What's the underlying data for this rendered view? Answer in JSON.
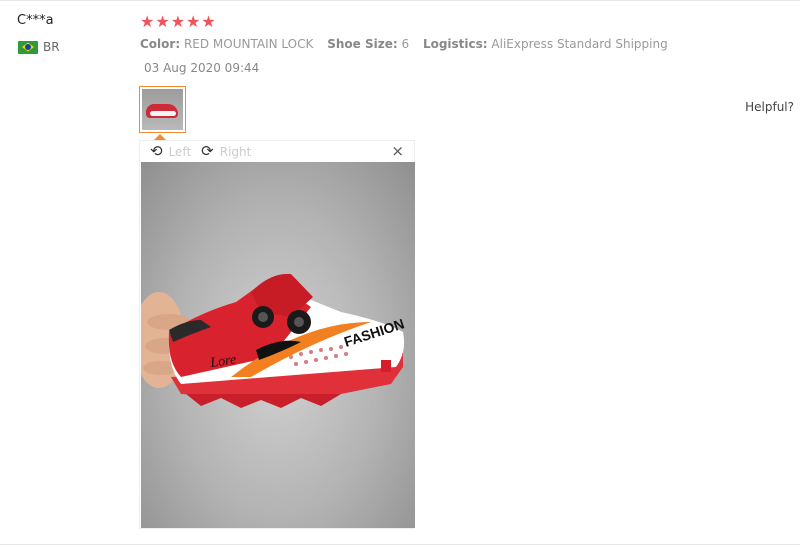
{
  "review": {
    "username": "C***a",
    "country_code": "BR",
    "flag_icon": "brazil-flag-icon",
    "rating": 5,
    "star_color": "#f0535c",
    "sku": [
      {
        "key": "Color:",
        "value": "RED MOUNTAIN LOCK"
      },
      {
        "key": "Shoe Size:",
        "value": "6"
      },
      {
        "key": "Logistics:",
        "value": "AliExpress Standard Shipping"
      }
    ],
    "date": "03 Aug 2020 09:44",
    "helpful_label": "Helpful?"
  },
  "viewer": {
    "rotate_left_label": "Left",
    "rotate_right_label": "Right",
    "close_glyph": "×",
    "rotate_left_icon": "rotate-left-icon",
    "rotate_right_icon": "rotate-right-icon",
    "accent_color": "#f28a30",
    "shoe_brand_text": "FASHION",
    "shoe_script_text": "Lore"
  }
}
